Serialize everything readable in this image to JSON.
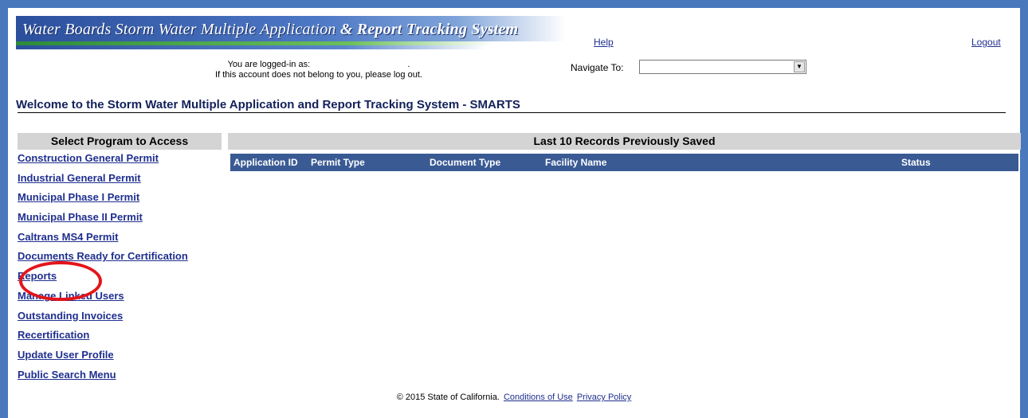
{
  "header": {
    "title_plain": "Water Boards  Storm Water Multiple Application ",
    "title_ampersand": "&",
    "title_tail": " Report Tracking System",
    "help_label": "Help",
    "logout_label": "Logout",
    "logged_in_line": "You are logged-in as:                                        .",
    "account_notice": "If this account does not belong to you, please log out.",
    "navigate_label": "Navigate To:",
    "navigate_value": ""
  },
  "welcome": "Welcome to the Storm Water Multiple Application and Report Tracking System - SMARTS",
  "sidebar": {
    "header": "Select Program to Access",
    "items": [
      {
        "label": "Construction General Permit"
      },
      {
        "label": "Industrial General Permit"
      },
      {
        "label": "Municipal Phase I Permit"
      },
      {
        "label": "Municipal Phase II Permit"
      },
      {
        "label": "Caltrans MS4 Permit"
      },
      {
        "label": "Documents Ready for Certification"
      },
      {
        "label": "Reports"
      },
      {
        "label": "Manage Linked Users"
      },
      {
        "label": "Outstanding Invoices"
      },
      {
        "label": "Recertification"
      },
      {
        "label": "Update User Profile"
      },
      {
        "label": "Public Search Menu"
      }
    ]
  },
  "records": {
    "header": "Last 10 Records Previously Saved",
    "columns": [
      "Application ID",
      "Permit Type",
      "Document Type",
      "Facility Name",
      "Status"
    ]
  },
  "footer": {
    "copyright": "© 2015 State of California.",
    "conditions_label": "Conditions of Use",
    "privacy_label": "Privacy Policy"
  },
  "colors": {
    "frame_border": "#4a78bd",
    "table_header_bg": "#3a5a94",
    "section_header_bg": "#d4d4d4",
    "link": "#1f2f8f",
    "highlight": "#e3151a"
  }
}
